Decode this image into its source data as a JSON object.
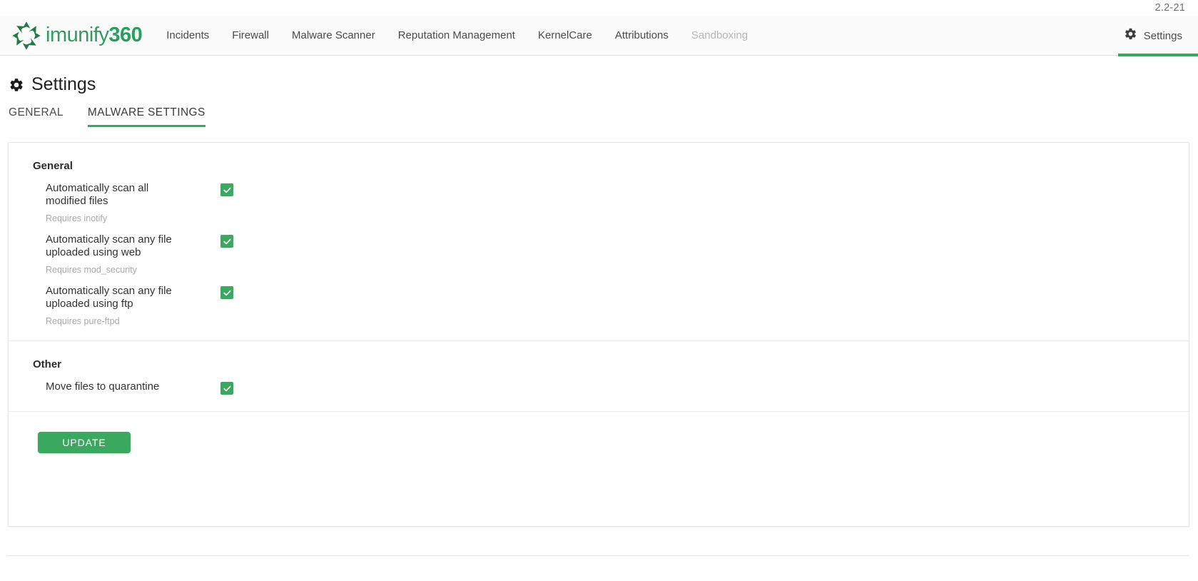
{
  "app": {
    "version": "2.2-21",
    "brand_name_light": "imunify",
    "brand_name_bold": "360",
    "accent_color": "#3aa85f",
    "logo_icon": "imunify-star-logo-icon"
  },
  "navbar": {
    "items": [
      {
        "label": "Incidents",
        "disabled": false
      },
      {
        "label": "Firewall",
        "disabled": false
      },
      {
        "label": "Malware Scanner",
        "disabled": false
      },
      {
        "label": "Reputation Management",
        "disabled": false
      },
      {
        "label": "KernelCare",
        "disabled": false
      },
      {
        "label": "Attributions",
        "disabled": false
      },
      {
        "label": "Sandboxing",
        "disabled": true
      }
    ],
    "settings": {
      "label": "Settings",
      "icon": "gear-icon",
      "active": true
    }
  },
  "page": {
    "title": "Settings",
    "title_icon": "gear-icon"
  },
  "tabs": [
    {
      "label": "GENERAL",
      "active": false
    },
    {
      "label": "MALWARE SETTINGS",
      "active": true
    }
  ],
  "sections": [
    {
      "title": "General",
      "rows": [
        {
          "label": "Automatically scan all modified files",
          "hint": "Requires inotify",
          "checked": true
        },
        {
          "label": "Automatically scan any file uploaded using web",
          "hint": "Requires mod_security",
          "checked": true
        },
        {
          "label": "Automatically scan any file uploaded using ftp",
          "hint": "Requires pure-ftpd",
          "checked": true
        }
      ]
    },
    {
      "title": "Other",
      "rows": [
        {
          "label": "Move files to quarantine",
          "hint": "",
          "checked": true
        }
      ]
    }
  ],
  "actions": {
    "update_label": "UPDATE"
  }
}
